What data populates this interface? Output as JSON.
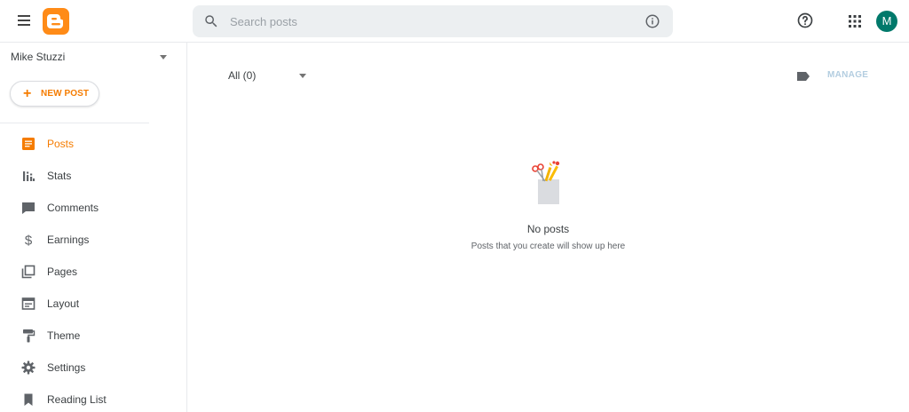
{
  "header": {
    "search_placeholder": "Search posts",
    "avatar_initial": "M"
  },
  "sidebar": {
    "blog_name": "Mike Stuzzi",
    "new_post_label": "NEW POST",
    "items": [
      {
        "label": "Posts",
        "icon": "posts-icon",
        "active": true
      },
      {
        "label": "Stats",
        "icon": "stats-icon"
      },
      {
        "label": "Comments",
        "icon": "comments-icon"
      },
      {
        "label": "Earnings",
        "icon": "dollar-icon"
      },
      {
        "label": "Pages",
        "icon": "pages-icon"
      },
      {
        "label": "Layout",
        "icon": "layout-icon"
      },
      {
        "label": "Theme",
        "icon": "paint-roller-icon"
      },
      {
        "label": "Settings",
        "icon": "gear-icon"
      },
      {
        "label": "Reading List",
        "icon": "bookmark-icon"
      }
    ]
  },
  "main": {
    "filter_label": "All (0)",
    "manage_label": "MANAGE",
    "empty_title": "No posts",
    "empty_subtitle": "Posts that you create will show up here"
  },
  "colors": {
    "accent": "#f57c00",
    "logo": "#ff8b17",
    "avatar": "#00796b",
    "manage_disabled": "#b3cde0"
  }
}
